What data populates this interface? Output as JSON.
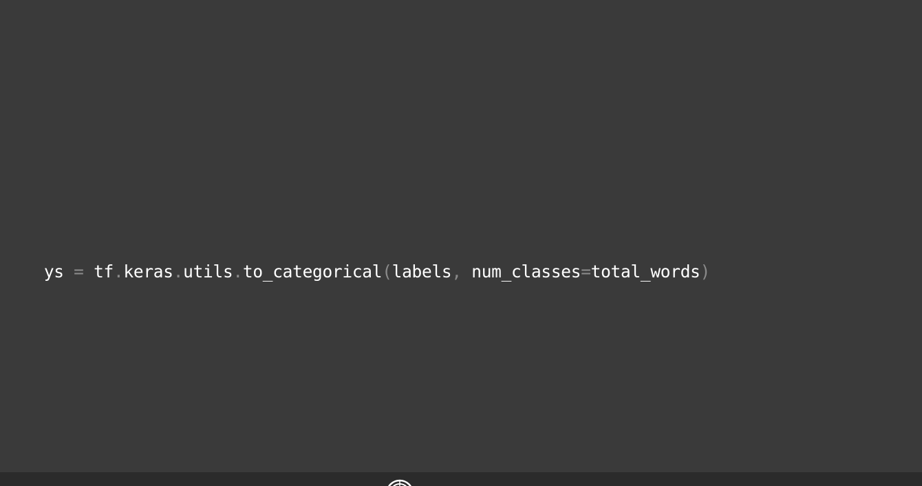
{
  "code": {
    "tokens": [
      {
        "text": "ys",
        "kind": "ident"
      },
      {
        "text": " = ",
        "kind": "punct"
      },
      {
        "text": "tf",
        "kind": "ident"
      },
      {
        "text": ".",
        "kind": "punct"
      },
      {
        "text": "keras",
        "kind": "ident"
      },
      {
        "text": ".",
        "kind": "punct"
      },
      {
        "text": "utils",
        "kind": "ident"
      },
      {
        "text": ".",
        "kind": "punct"
      },
      {
        "text": "to_categorical",
        "kind": "ident"
      },
      {
        "text": "(",
        "kind": "punct"
      },
      {
        "text": "labels",
        "kind": "ident"
      },
      {
        "text": ", ",
        "kind": "punct"
      },
      {
        "text": "num_classes",
        "kind": "ident"
      },
      {
        "text": "=",
        "kind": "punct"
      },
      {
        "text": "total_words",
        "kind": "ident"
      },
      {
        "text": ")",
        "kind": "punct"
      }
    ]
  },
  "colors": {
    "background": "#3a3a3a",
    "code_text": "#ffffff",
    "punctuation": "#8a8a8a",
    "bottom_bar": "#2b2b2b"
  },
  "bottom_bar": {
    "logo_icon": "circular-logo-icon"
  }
}
